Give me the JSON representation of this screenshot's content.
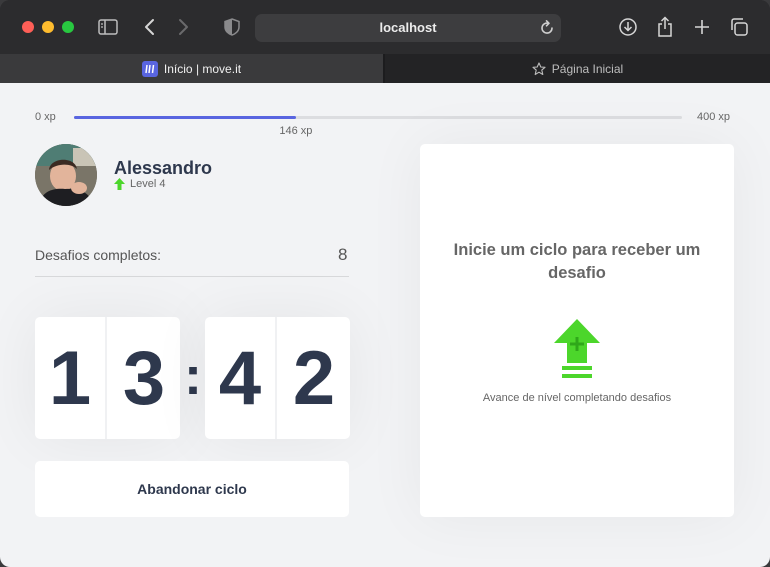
{
  "browser": {
    "address": "localhost",
    "tabs": [
      {
        "label": "Início | move.it",
        "active": true
      },
      {
        "label": "Página Inicial",
        "active": false
      }
    ]
  },
  "experience": {
    "min_label": "0 xp",
    "max_label": "400 xp",
    "current_label": "146 xp",
    "current": 146,
    "max": 400
  },
  "profile": {
    "name": "Alessandro",
    "level_label": "Level 4"
  },
  "challenges": {
    "label": "Desafios completos:",
    "count": "8"
  },
  "countdown": {
    "minute_left": "1",
    "minute_right": "3",
    "separator": ":",
    "second_left": "4",
    "second_right": "2"
  },
  "actions": {
    "abandon_label": "Abandonar ciclo"
  },
  "challenge_box": {
    "title": "Inicie um ciclo para receber um desafio",
    "hint": "Avance de nível completando desafios"
  },
  "colors": {
    "accent": "#5965e0",
    "level_green": "#4cd62b",
    "text_dark": "#2e384d"
  },
  "icons": {
    "level": "level-up-arrow-icon",
    "tab_favicon": "moveit-logo-icon",
    "bookmark": "star-icon"
  }
}
